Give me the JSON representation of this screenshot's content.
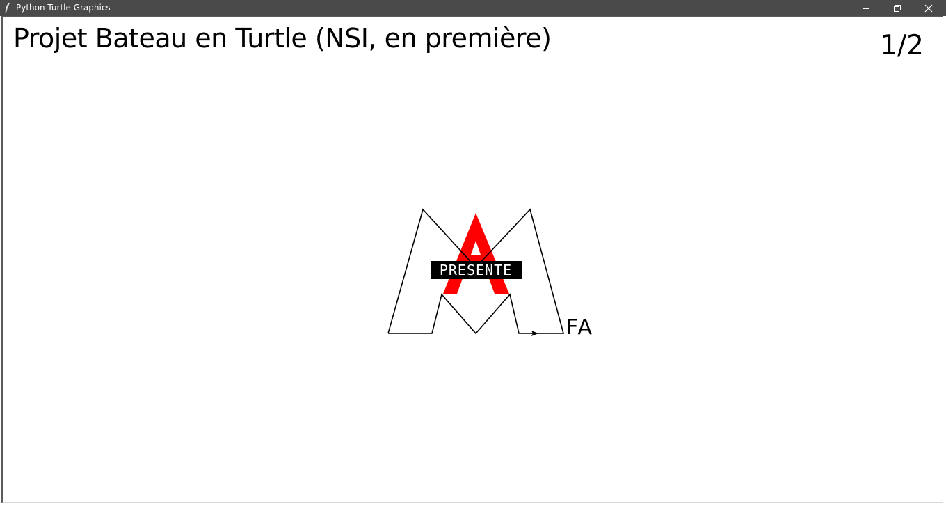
{
  "window": {
    "title": "Python Turtle Graphics",
    "icon": "feather-icon",
    "controls": [
      "minimize-icon",
      "restore-icon",
      "close-icon"
    ]
  },
  "canvas": {
    "title": "Projet Bateau en Turtle (NSI, en première)",
    "page_counter": "1/2",
    "logo": {
      "badge_text": "PRESENTE",
      "side_text": "FA",
      "colors": {
        "outline": "#000000",
        "letter_a": "#ff0000",
        "badge_bg": "#000000",
        "badge_text": "#ffffff"
      }
    }
  },
  "colors": {
    "titlebar": "#4a4a4a",
    "background": "#ffffff"
  }
}
